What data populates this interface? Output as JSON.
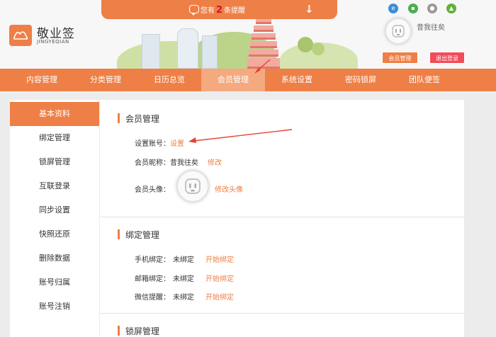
{
  "notice": {
    "prefix": "您有",
    "count": "2",
    "suffix": "条提醒",
    "down_icon": "arrow-down-icon"
  },
  "brand": {
    "name": "敬业签",
    "subtitle": "JINGYEQIAN"
  },
  "user": {
    "name": "昔我往矣"
  },
  "top_buttons": {
    "member": "会员管理",
    "logout": "退出登录"
  },
  "nav": [
    {
      "label": "内容管理"
    },
    {
      "label": "分类管理"
    },
    {
      "label": "日历总览"
    },
    {
      "label": "会员管理"
    },
    {
      "label": "系统设置"
    },
    {
      "label": "密码锁屏"
    },
    {
      "label": "团队便签"
    }
  ],
  "sidebar": [
    {
      "label": "基本资料"
    },
    {
      "label": "绑定管理"
    },
    {
      "label": "锁屏管理"
    },
    {
      "label": "互联登录"
    },
    {
      "label": "同步设置"
    },
    {
      "label": "快照还原"
    },
    {
      "label": "删除数据"
    },
    {
      "label": "账号归属"
    },
    {
      "label": "账号注销"
    }
  ],
  "member_section": {
    "title": "会员管理",
    "account_label": "设置账号：",
    "account_link": "设置",
    "nickname_label": "会员昵称：",
    "nickname_value": "昔我往矣",
    "nickname_link": "修改",
    "avatar_label": "会员头像：",
    "avatar_link": "修改头像"
  },
  "bind_section": {
    "title": "绑定管理",
    "rows": [
      {
        "label": "手机绑定：",
        "status": "未绑定",
        "action": "开始绑定"
      },
      {
        "label": "邮箱绑定：",
        "status": "未绑定",
        "action": "开始绑定"
      },
      {
        "label": "微信提醒：",
        "status": "未绑定",
        "action": "开始绑定"
      }
    ]
  },
  "lock_section": {
    "title": "锁屏管理"
  },
  "colors": {
    "accent": "#ee7f46",
    "logout": "#f24b5a",
    "count": "#d9112a"
  }
}
